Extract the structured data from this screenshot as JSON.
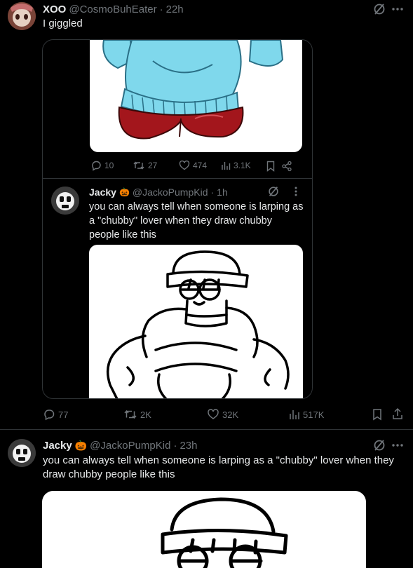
{
  "post1": {
    "display_name": "XOO",
    "handle": "@CosmoBuhEater",
    "time": "22h",
    "text": "I giggled"
  },
  "quoted_stats": {
    "replies": "10",
    "reposts": "27",
    "likes": "474",
    "views": "3.1K"
  },
  "quoted": {
    "display_name": "Jacky",
    "badge_emoji": "🎃",
    "handle": "@JackoPumpKid",
    "time": "1h",
    "text": "you can always tell when someone is larping as a \"chubby\" lover when they draw chubby people like this"
  },
  "post1_stats": {
    "replies": "77",
    "reposts": "2K",
    "likes": "32K",
    "views": "517K"
  },
  "post2": {
    "display_name": "Jacky",
    "badge_emoji": "🎃",
    "handle": "@JackoPumpKid",
    "time": "23h",
    "text": "you can always tell when someone is larping as a \"chubby\" lover when they draw chubby people like this"
  },
  "separator": "·",
  "colors": {
    "background": "#000000",
    "text": "#e7e9ea",
    "muted": "#71767b",
    "border": "#2f3336",
    "badge": "#f4900c"
  }
}
